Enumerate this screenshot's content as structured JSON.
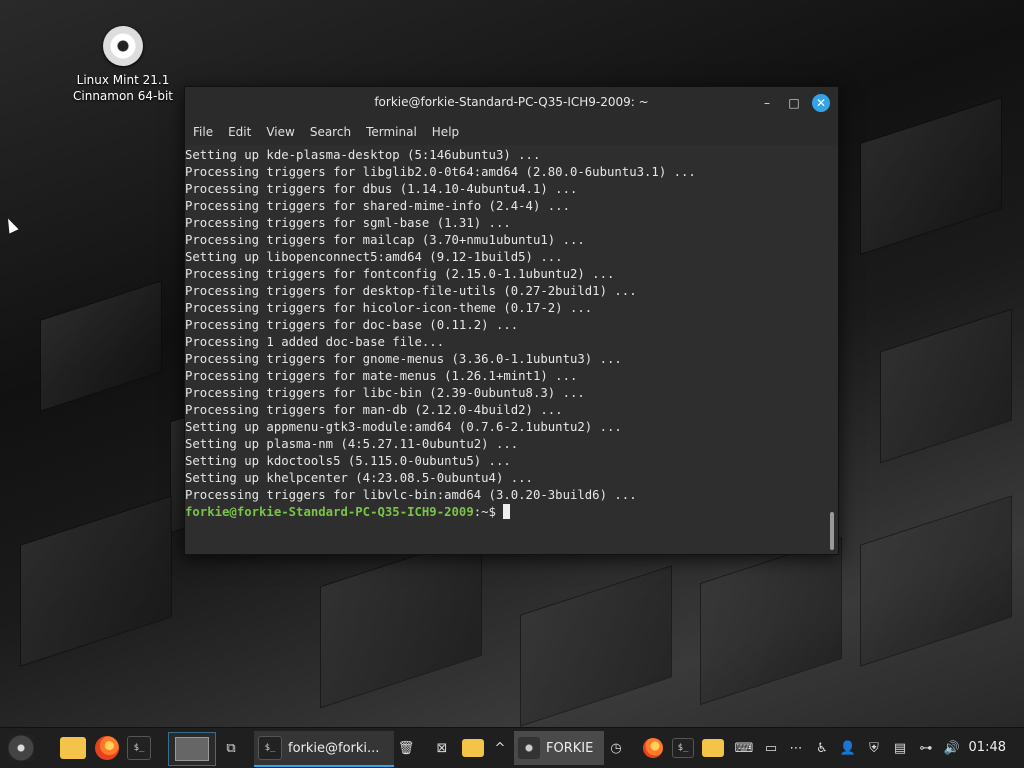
{
  "desktop": {
    "icon_label_1": "Linux Mint 21.1",
    "icon_label_2": "Cinnamon 64-bit"
  },
  "window": {
    "title": "forkie@forkie-Standard-PC-Q35-ICH9-2009: ~",
    "minimize": "–",
    "maximize": "□",
    "close": "✕"
  },
  "menu": [
    "File",
    "Edit",
    "View",
    "Search",
    "Terminal",
    "Help"
  ],
  "terminal": {
    "lines": [
      "Setting up kde-plasma-desktop (5:146ubuntu3) ...",
      "Processing triggers for libglib2.0-0t64:amd64 (2.80.0-6ubuntu3.1) ...",
      "Processing triggers for dbus (1.14.10-4ubuntu4.1) ...",
      "Processing triggers for shared-mime-info (2.4-4) ...",
      "Processing triggers for sgml-base (1.31) ...",
      "Processing triggers for mailcap (3.70+nmu1ubuntu1) ...",
      "Setting up libopenconnect5:amd64 (9.12-1build5) ...",
      "Processing triggers for fontconfig (2.15.0-1.1ubuntu2) ...",
      "Processing triggers for desktop-file-utils (0.27-2build1) ...",
      "Processing triggers for hicolor-icon-theme (0.17-2) ...",
      "Processing triggers for doc-base (0.11.2) ...",
      "Processing 1 added doc-base file...",
      "Processing triggers for gnome-menus (3.36.0-1.1ubuntu3) ...",
      "Processing triggers for mate-menus (1.26.1+mint1) ...",
      "Processing triggers for libc-bin (2.39-0ubuntu8.3) ...",
      "Processing triggers for man-db (2.12.0-4build2) ...",
      "Setting up appmenu-gtk3-module:amd64 (0.7.6-2.1ubuntu2) ...",
      "Setting up plasma-nm (4:5.27.11-0ubuntu2) ...",
      "Setting up kdoctools5 (5.115.0-0ubuntu5) ...",
      "Setting up khelpcenter (4:23.08.5-0ubuntu4) ...",
      "Processing triggers for libvlc-bin:amd64 (3.0.20-3build6) ..."
    ],
    "prompt_user": "forkie@forkie-Standard-PC-Q35-ICH9-2009",
    "prompt_suffix": ":~$ "
  },
  "taskbar": {
    "terminal_task": "forkie@forki...",
    "forkie_task": "FORKIE",
    "terminal_glyph": "$_",
    "clock": "01:48"
  }
}
